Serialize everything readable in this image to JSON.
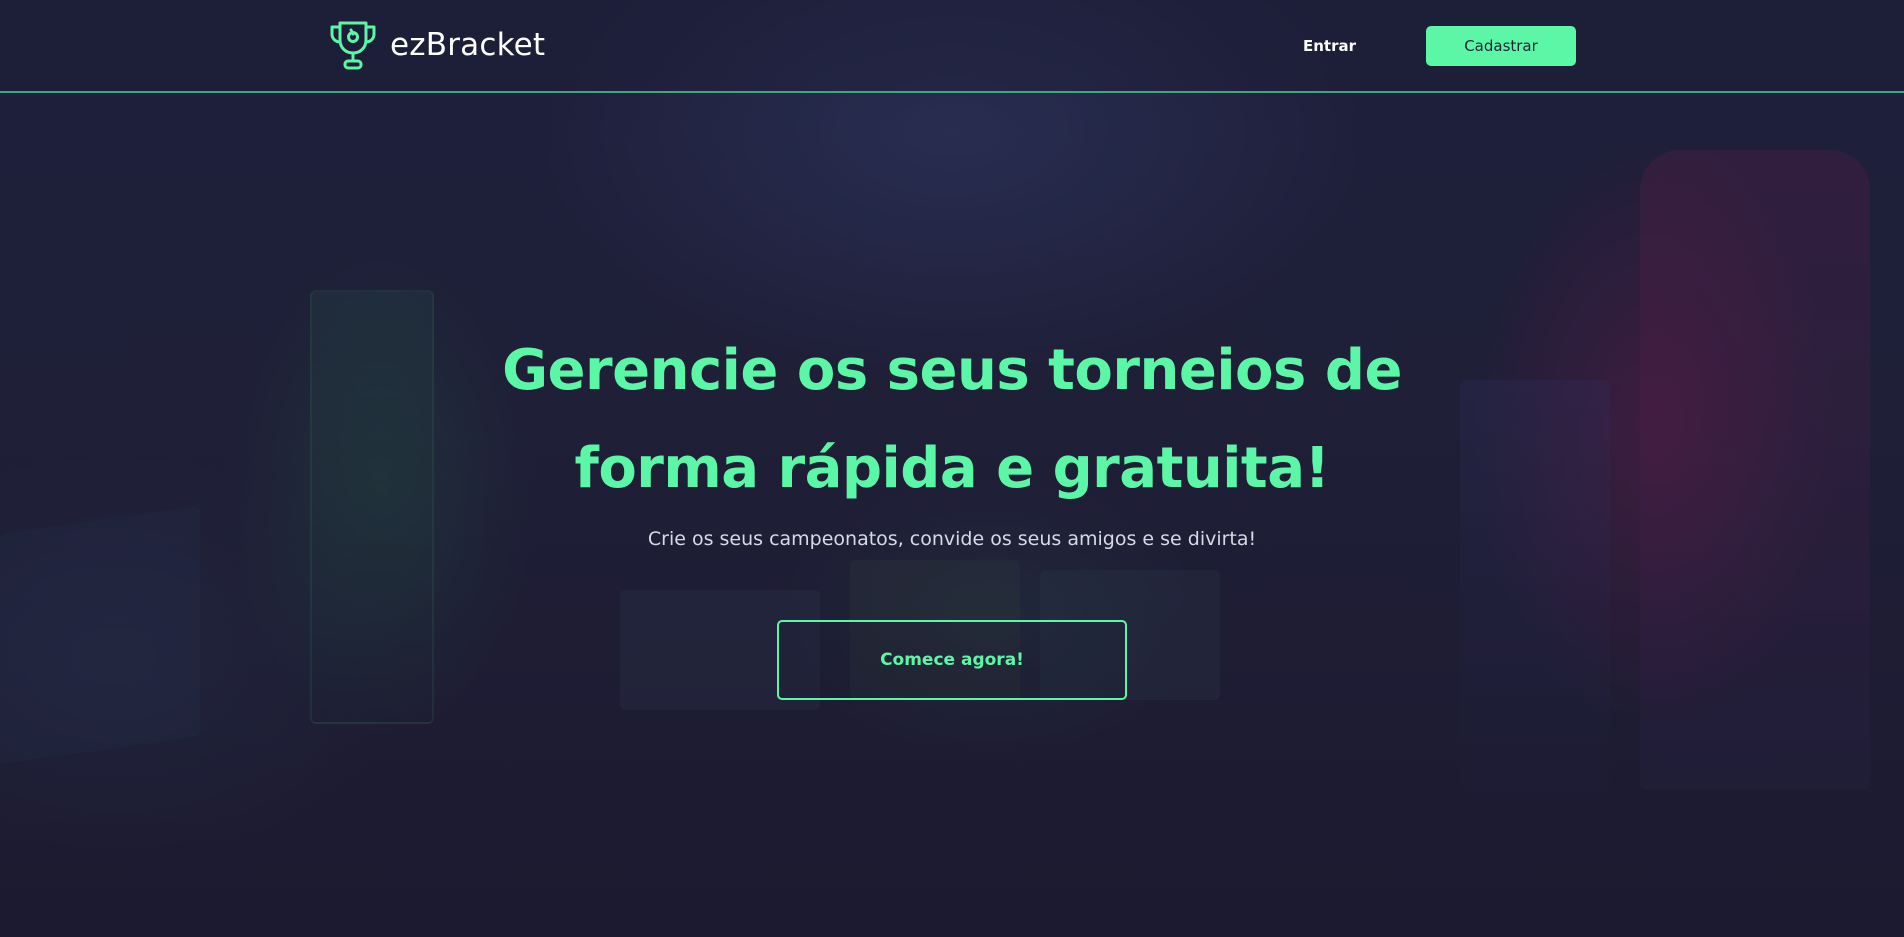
{
  "brand": {
    "name": "ezBracket",
    "icon": "trophy-icon",
    "accent_color": "#5cf7a6"
  },
  "nav": {
    "login_label": "Entrar",
    "signup_label": "Cadastrar"
  },
  "hero": {
    "title_line1": "Gerencie os seus torneios de",
    "title_line2": "forma rápida e gratuita!",
    "subtitle": "Crie os seus campeonatos, convide os seus amigos e se divirta!",
    "cta_label": "Comece agora!"
  },
  "colors": {
    "background": "#1e1d33",
    "accent": "#5cf7a6",
    "header_border": "#3fa67f",
    "text_light": "#ffffff",
    "subtitle_text": "#d8d9e6"
  }
}
